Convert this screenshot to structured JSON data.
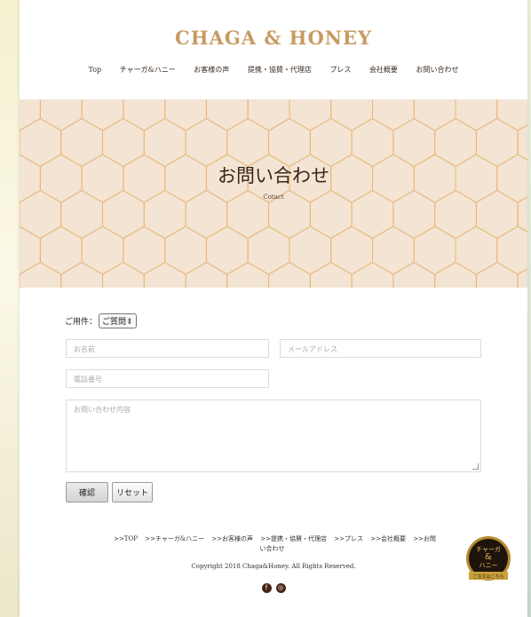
{
  "brand": {
    "name": "CHAGA & HONEY"
  },
  "nav": [
    {
      "label": "Top"
    },
    {
      "label": "チャーガ&ハニー"
    },
    {
      "label": "お客様の声"
    },
    {
      "label": "提携・協賛・代理店"
    },
    {
      "label": "プレス"
    },
    {
      "label": "会社概要"
    },
    {
      "label": "お問い合わせ"
    }
  ],
  "hero": {
    "title": "お問い合わせ",
    "subtitle": "Cotact"
  },
  "form": {
    "inquiry_label": "ご用件：",
    "inquiry_select_value": "ご質問",
    "name_placeholder": "お名前",
    "email_placeholder": "メールアドレス",
    "phone_placeholder": "電話番号",
    "message_placeholder": "お問い合わせ内容",
    "confirm_label": "確認",
    "reset_label": "リセット"
  },
  "footer": {
    "links": [
      {
        "label": ">>TOP"
      },
      {
        "label": ">>チャーガ&ハニー"
      },
      {
        "label": ">>お客様の声"
      },
      {
        "label": ">>提携・協賛・代理店"
      },
      {
        "label": ">>プレス"
      },
      {
        "label": ">>会社概要"
      },
      {
        "label": ">>お問い合わせ"
      }
    ],
    "copyright": "Copyright 2018 Chaga&Honey. All Rights Reserved.",
    "social": [
      {
        "icon": "facebook-icon",
        "glyph": "f"
      },
      {
        "icon": "instagram-icon",
        "glyph": "◎"
      }
    ]
  },
  "badge": {
    "line1": "チャーガ",
    "line2": "&",
    "line3": "ハニー",
    "line4": "ご注文はこちら"
  },
  "colors": {
    "brand": "#c79a62",
    "hero_bg": "#f3e4d3",
    "hex_stroke": "#e8b779"
  }
}
